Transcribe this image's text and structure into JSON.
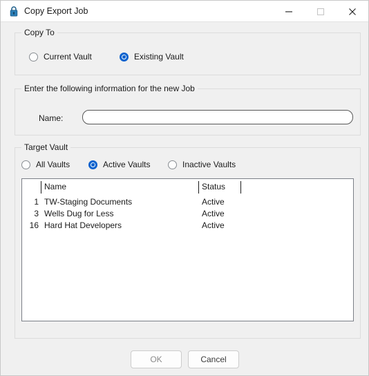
{
  "window": {
    "title": "Copy Export Job",
    "icon": "lock-icon",
    "controls": {
      "minimize": "minimize-icon",
      "maximize": "maximize-icon",
      "close": "close-icon"
    }
  },
  "copy_to": {
    "legend": "Copy To",
    "options": [
      {
        "label": "Current Vault",
        "selected": false
      },
      {
        "label": "Existing Vault",
        "selected": true
      }
    ]
  },
  "new_job": {
    "legend": "Enter the following information for the new Job",
    "name_label": "Name:",
    "name_value": "",
    "name_placeholder": ""
  },
  "target_vault": {
    "legend": "Target Vault",
    "filters": [
      {
        "label": "All Vaults",
        "selected": false
      },
      {
        "label": "Active Vaults",
        "selected": true
      },
      {
        "label": "Inactive Vaults",
        "selected": false
      }
    ],
    "table": {
      "columns": [
        "",
        "Name",
        "Status",
        ""
      ],
      "rows": [
        {
          "id": "1",
          "name": "TW-Staging Documents",
          "status": "Active"
        },
        {
          "id": "3",
          "name": "Wells Dug for Less",
          "status": "Active"
        },
        {
          "id": "16",
          "name": "Hard Hat Developers",
          "status": "Active"
        }
      ]
    }
  },
  "footer": {
    "ok_label": "OK",
    "cancel_label": "Cancel"
  },
  "colors": {
    "accent": "#0b63ce",
    "dialog_bg": "#f0f0f0",
    "titlebar_bg": "#ffffff",
    "field_bg": "#ffffff",
    "text": "#1a1a1a",
    "disabled_text": "#8a8a8a"
  }
}
